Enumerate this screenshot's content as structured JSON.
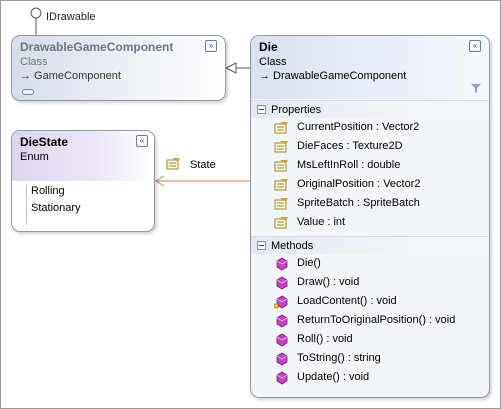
{
  "interface_lollipop": {
    "label": "IDrawable"
  },
  "drawable_game_component": {
    "name": "DrawableGameComponent",
    "kind": "Class",
    "base": "→ GameComponent",
    "collapse_glyph": "»",
    "icon": "expand-tab-icon"
  },
  "die_state": {
    "name": "DieState",
    "kind": "Enum",
    "collapse_glyph": "«",
    "values": [
      "Rolling",
      "Stationary"
    ]
  },
  "association": {
    "label": "State",
    "icon": "property-icon",
    "color": "#c8805a"
  },
  "die": {
    "name": "Die",
    "kind": "Class",
    "base": "→ DrawableGameComponent",
    "collapse_glyph": "«",
    "filter_icon": "filter-icon",
    "properties_title": "Properties",
    "properties": [
      "CurrentPosition : Vector2",
      "DieFaces : Texture2D",
      "MsLeftInRoll : double",
      "OriginalPosition : Vector2",
      "SpriteBatch : SpriteBatch",
      "Value : int"
    ],
    "methods_title": "Methods",
    "methods": [
      {
        "label": "Die()",
        "icon": "method-icon"
      },
      {
        "label": "Draw() : void",
        "icon": "method-icon"
      },
      {
        "label": "LoadContent() : void",
        "icon": "protected-method-icon"
      },
      {
        "label": "ReturnToOriginalPosition() : void",
        "icon": "method-icon"
      },
      {
        "label": "Roll() : void",
        "icon": "method-icon"
      },
      {
        "label": "ToString() : string",
        "icon": "method-icon"
      },
      {
        "label": "Update() : void",
        "icon": "method-icon"
      }
    ]
  },
  "colors": {
    "class_header": "#d9e0ef",
    "enum_header": "#ddd5ee",
    "association_line": "#c8805a",
    "inheritance_line": "#555555",
    "method_icon": "#c044c0",
    "property_icon": "#c8a83c"
  }
}
